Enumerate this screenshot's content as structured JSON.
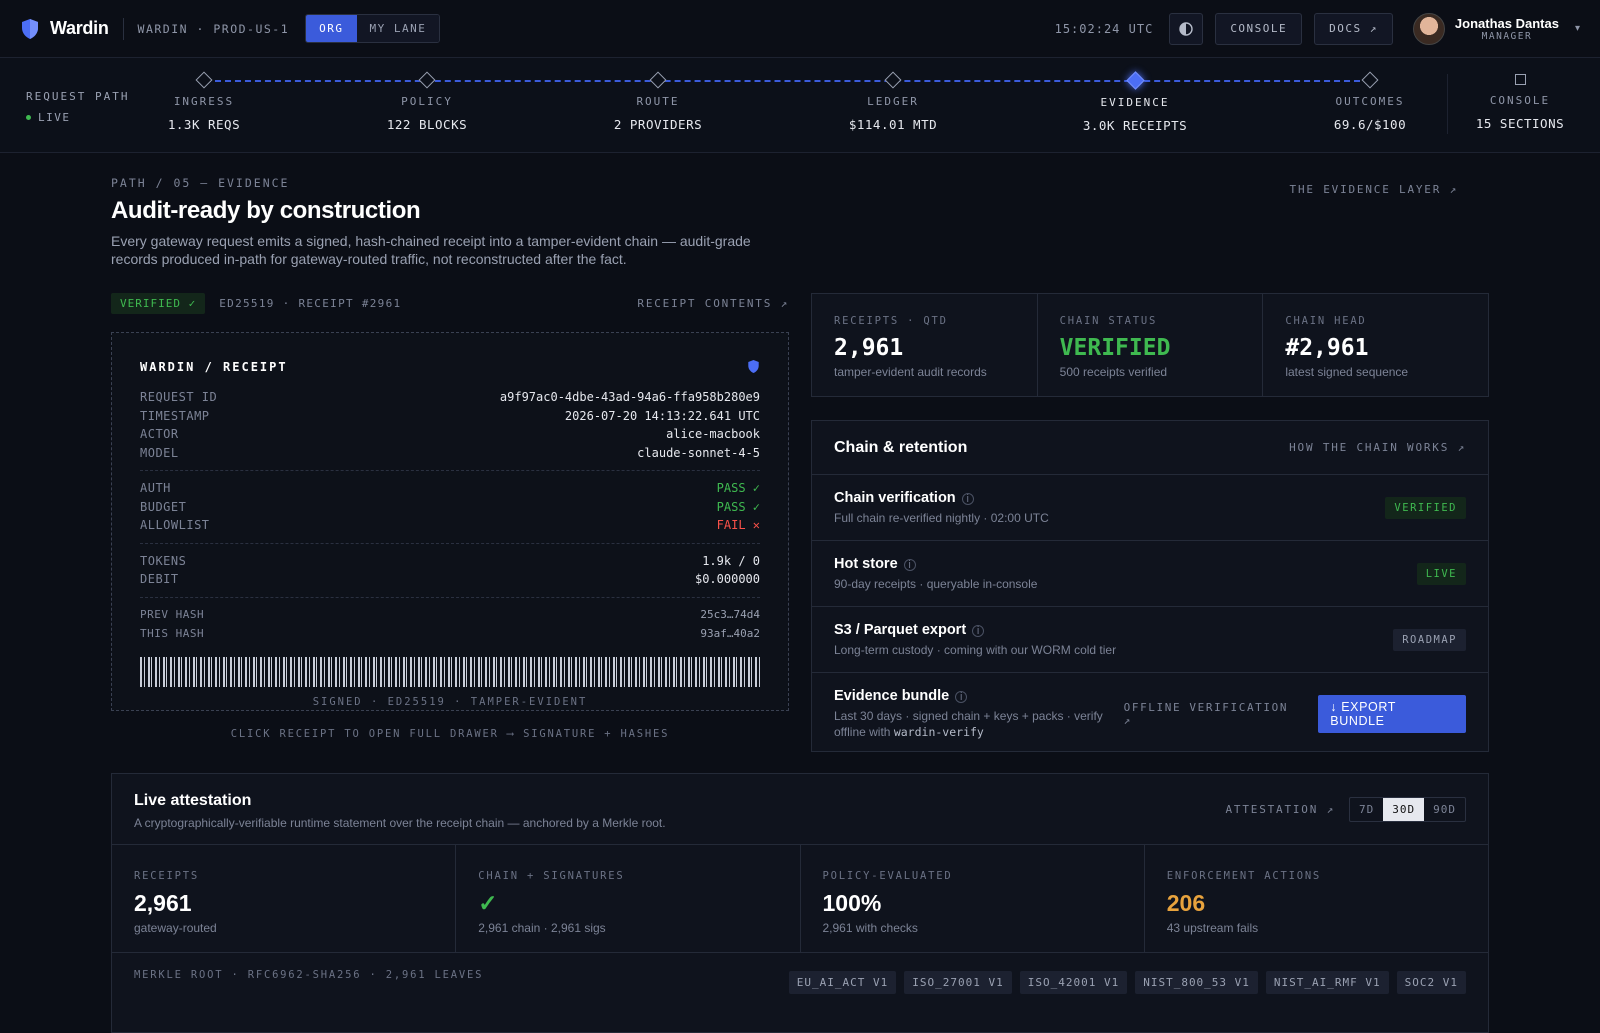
{
  "app": {
    "brand": "Wardin",
    "env": "WARDIN · PROD-US-1",
    "scope_tabs": [
      "ORG",
      "MY LANE"
    ],
    "active_scope": "ORG"
  },
  "topbar": {
    "clock": "15:02:24 UTC",
    "console_label": "CONSOLE",
    "docs_label": "DOCS ↗",
    "user_name": "Jonathas Dantas",
    "user_role": "MANAGER",
    "theme_icon": "contrast-icon"
  },
  "request_path": {
    "label": "REQUEST PATH",
    "status": "LIVE",
    "stages": [
      {
        "name": "INGRESS",
        "value": "1.3K REQS"
      },
      {
        "name": "POLICY",
        "value": "122 BLOCKS"
      },
      {
        "name": "ROUTE",
        "value": "2 PROVIDERS"
      },
      {
        "name": "LEDGER",
        "value": "$114.01 MTD"
      },
      {
        "name": "EVIDENCE",
        "value": "3.0K RECEIPTS"
      },
      {
        "name": "OUTCOMES",
        "value": "69.6/$100"
      },
      {
        "name": "CONSOLE",
        "value": "15 SECTIONS"
      }
    ],
    "active_stage": "EVIDENCE"
  },
  "page": {
    "crumb": "PATH / 05 — EVIDENCE",
    "title": "Audit-ready by construction",
    "subtitle": "Every gateway request emits a signed, hash-chained receipt into a tamper-evident chain — audit-grade records produced in-path for gateway-routed traffic, not reconstructed after the fact.",
    "layer_link": "THE EVIDENCE LAYER ↗"
  },
  "receipt": {
    "badge": "VERIFIED ✓",
    "meta": "ED25519 · RECEIPT #2961",
    "contents_link": "RECEIPT CONTENTS ↗",
    "title": "WARDIN / RECEIPT",
    "fields": [
      {
        "k": "REQUEST ID",
        "v": "a9f97ac0-4dbe-43ad-94a6-ffa958b280e9"
      },
      {
        "k": "TIMESTAMP",
        "v": "2026-07-20 14:13:22.641 UTC"
      },
      {
        "k": "ACTOR",
        "v": "alice-macbook"
      },
      {
        "k": "MODEL",
        "v": "claude-sonnet-4-5"
      }
    ],
    "checks": [
      {
        "k": "AUTH",
        "v": "PASS ✓"
      },
      {
        "k": "BUDGET",
        "v": "PASS ✓"
      },
      {
        "k": "ALLOWLIST",
        "v": "FAIL ✕"
      }
    ],
    "usage": [
      {
        "k": "TOKENS",
        "v": "1.9k / 0"
      },
      {
        "k": "DEBIT",
        "v": "$0.000000"
      }
    ],
    "hashes": [
      {
        "k": "PREV HASH",
        "v": "25c3…74d4"
      },
      {
        "k": "THIS HASH",
        "v": "93af…40a2"
      }
    ],
    "signed": "SIGNED · ED25519 · TAMPER-EVIDENT",
    "hint": "CLICK RECEIPT TO OPEN FULL DRAWER ⟶ SIGNATURE + HASHES"
  },
  "stats": [
    {
      "label": "RECEIPTS · QTD",
      "value": "2,961",
      "desc": "tamper-evident audit records"
    },
    {
      "label": "CHAIN STATUS",
      "value": "VERIFIED",
      "desc": "500 receipts verified"
    },
    {
      "label": "CHAIN HEAD",
      "value": "#2,961",
      "desc": "latest signed sequence"
    }
  ],
  "chain": {
    "title": "Chain & retention",
    "link": "HOW THE CHAIN WORKS ↗",
    "rows": [
      {
        "title": "Chain verification",
        "desc": "Full chain re-verified nightly · 02:00 UTC",
        "pill": "VERIFIED"
      },
      {
        "title": "Hot store",
        "desc": "90-day receipts · queryable in-console",
        "pill": "LIVE"
      },
      {
        "title": "S3 / Parquet export",
        "desc": "Long-term custody · coming with our WORM cold tier",
        "pill": "ROADMAP"
      },
      {
        "title": "Evidence bundle",
        "desc": "Last 30 days · signed chain + keys + packs · verify offline with",
        "desc_code": "wardin-verify",
        "link": "OFFLINE VERIFICATION ↗",
        "button": "↓ EXPORT BUNDLE"
      }
    ]
  },
  "attestation": {
    "title": "Live attestation",
    "desc": "A cryptographically-verifiable runtime statement over the receipt chain — anchored by a Merkle root.",
    "link": "ATTESTATION ↗",
    "ranges": [
      "7D",
      "30D",
      "90D"
    ],
    "active_range": "30D",
    "stats": [
      {
        "label": "RECEIPTS",
        "value": "2,961",
        "desc": "gateway-routed"
      },
      {
        "label": "CHAIN + SIGNATURES",
        "value": "✓",
        "desc": "2,961 chain · 2,961 sigs"
      },
      {
        "label": "POLICY-EVALUATED",
        "value": "100%",
        "desc": "2,961 with checks"
      },
      {
        "label": "ENFORCEMENT ACTIONS",
        "value": "206",
        "desc": "43 upstream fails"
      }
    ],
    "merkle_label": "MERKLE ROOT · RFC6962-SHA256 · 2,961 LEAVES",
    "frameworks": [
      "EU_AI_ACT V1",
      "ISO_27001 V1",
      "ISO_42001 V1",
      "NIST_800_53 V1",
      "NIST_AI_RMF V1",
      "SOC2 V1"
    ]
  },
  "colors": {
    "accent": "#3b5bdb",
    "pass": "#3fb950",
    "fail": "#f85149",
    "warn": "#e8a33d",
    "bg": "#0b0e16"
  }
}
